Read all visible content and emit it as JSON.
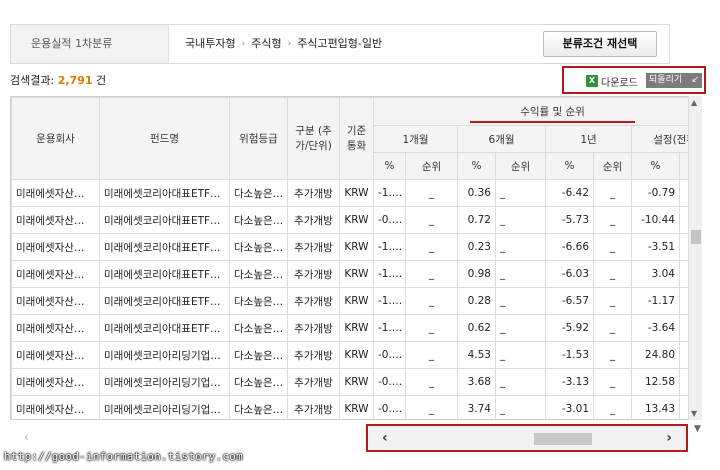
{
  "filter": {
    "label": "운용실적 1차분류",
    "crumbs": [
      "국내투자형",
      "주식형",
      "주식고편입형-일반"
    ],
    "separator": "›",
    "reselect_label": "분류조건 재선택"
  },
  "result": {
    "prefix": "검색결과:",
    "count": "2,791",
    "suffix": "건"
  },
  "toolbar": {
    "download_icon": "X",
    "download_label": "다운로드",
    "fold_label": "되돌리기",
    "fold_icon": "↙"
  },
  "table": {
    "headers": {
      "company": "운용회사",
      "fund": "펀드명",
      "risk": "위험등급",
      "type": "구분 (추가/단위)",
      "currency": "기준통화",
      "returns_group": "수익률 및 순위",
      "periods": [
        "1개월",
        "6개월",
        "1년",
        "설정(전환)일"
      ],
      "pct": "%",
      "rank": "순위"
    },
    "rows": [
      {
        "company": "미래에셋자산…",
        "fund": "미래에셋코리아대표ETF…",
        "risk": "다소높은…",
        "type": "추가개방",
        "currency": "KRW",
        "m1": "-1.…",
        "r1": "_",
        "m6": "0.36",
        "r6": "_",
        "y1": "-6.42",
        "ry": "_",
        "since": "-0.79",
        "rs": "_"
      },
      {
        "company": "미래에셋자산…",
        "fund": "미래에셋코리아대표ETF…",
        "risk": "다소높은…",
        "type": "추가개방",
        "currency": "KRW",
        "m1": "-0.…",
        "r1": "_",
        "m6": "0.72",
        "r6": "_",
        "y1": "-5.73",
        "ry": "_",
        "since": "-10.44",
        "rs": "_"
      },
      {
        "company": "미래에셋자산…",
        "fund": "미래에셋코리아대표ETF…",
        "risk": "다소높은…",
        "type": "추가개방",
        "currency": "KRW",
        "m1": "-1.…",
        "r1": "_",
        "m6": "0.23",
        "r6": "_",
        "y1": "-6.66",
        "ry": "_",
        "since": "-3.51",
        "rs": "_"
      },
      {
        "company": "미래에셋자산…",
        "fund": "미래에셋코리아대표ETF…",
        "risk": "다소높은…",
        "type": "추가개방",
        "currency": "KRW",
        "m1": "-1.…",
        "r1": "_",
        "m6": "0.98",
        "r6": "_",
        "y1": "-6.03",
        "ry": "_",
        "since": "3.04",
        "rs": "_"
      },
      {
        "company": "미래에셋자산…",
        "fund": "미래에셋코리아대표ETF…",
        "risk": "다소높은…",
        "type": "추가개방",
        "currency": "KRW",
        "m1": "-1.…",
        "r1": "_",
        "m6": "0.28",
        "r6": "_",
        "y1": "-6.57",
        "ry": "_",
        "since": "-1.17",
        "rs": "_"
      },
      {
        "company": "미래에셋자산…",
        "fund": "미래에셋코리아대표ETF…",
        "risk": "다소높은…",
        "type": "추가개방",
        "currency": "KRW",
        "m1": "-1.…",
        "r1": "_",
        "m6": "0.62",
        "r6": "_",
        "y1": "-5.92",
        "ry": "_",
        "since": "-3.64",
        "rs": "_"
      },
      {
        "company": "미래에셋자산…",
        "fund": "미래에셋코리아리딩기업…",
        "risk": "다소높은…",
        "type": "추가개방",
        "currency": "KRW",
        "m1": "-0.…",
        "r1": "_",
        "m6": "4.53",
        "r6": "_",
        "y1": "-1.53",
        "ry": "_",
        "since": "24.80",
        "rs": "_"
      },
      {
        "company": "미래에셋자산…",
        "fund": "미래에셋코리아리딩기업…",
        "risk": "다소높은…",
        "type": "추가개방",
        "currency": "KRW",
        "m1": "-0.…",
        "r1": "_",
        "m6": "3.68",
        "r6": "_",
        "y1": "-3.13",
        "ry": "_",
        "since": "12.58",
        "rs": "_"
      },
      {
        "company": "미래에셋자산…",
        "fund": "미래에셋코리아리딩기업…",
        "risk": "다소높은…",
        "type": "추가개방",
        "currency": "KRW",
        "m1": "-0.…",
        "r1": "_",
        "m6": "3.74",
        "r6": "_",
        "y1": "-3.01",
        "ry": "_",
        "since": "13.43",
        "rs": "_"
      }
    ]
  },
  "scroll": {
    "left_arrow": "‹",
    "right_arrow": "›",
    "up_arrow": "▲",
    "down_arrow": "▼"
  },
  "watermark": "http://good-information.tistory.com",
  "colors": {
    "accent_red": "#b41c1c",
    "count_orange": "#e07b00",
    "excel_green": "#2f8f3a"
  }
}
